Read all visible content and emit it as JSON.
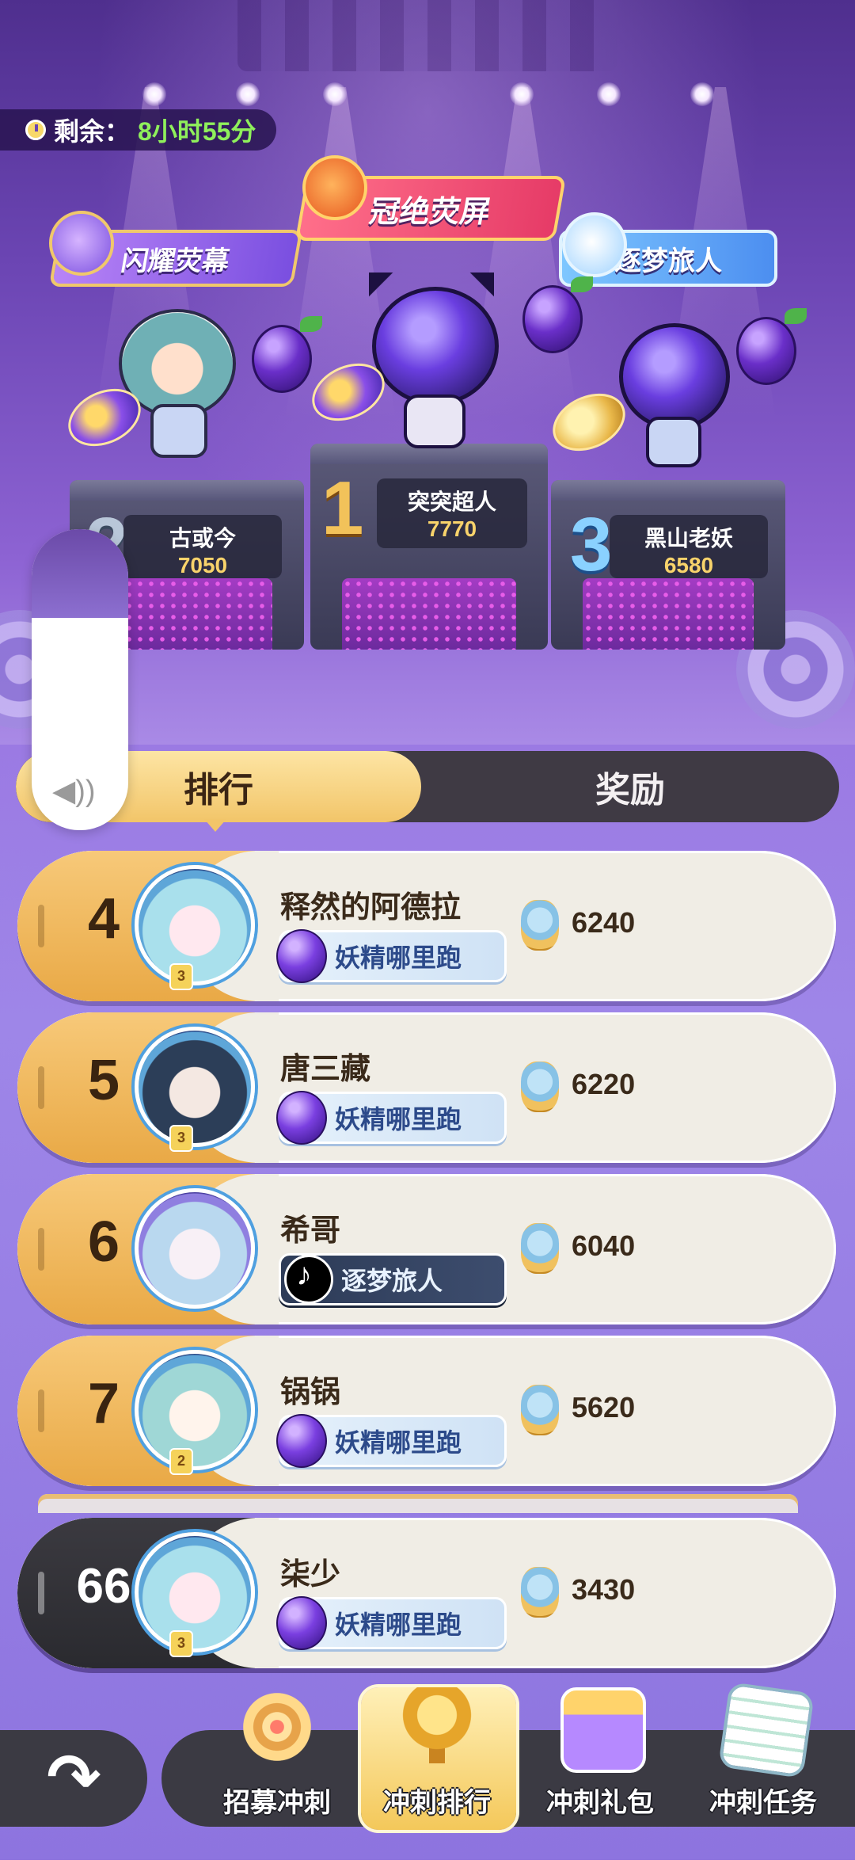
{
  "timer": {
    "label": "剩余：",
    "value": "8小时55分"
  },
  "banners": {
    "left": "闪耀荧幕",
    "center": "冠绝荧屏",
    "right": "逐梦旅人"
  },
  "podium": [
    {
      "rank": "1",
      "name": "突突超人",
      "score": "7770"
    },
    {
      "rank": "2",
      "name": "古或今",
      "score": "7050"
    },
    {
      "rank": "3",
      "name": "黑山老妖",
      "score": "6580"
    }
  ],
  "tabs": {
    "ranking": "排行",
    "rewards": "奖励"
  },
  "rows": [
    {
      "rank": "4",
      "name": "释然的阿德拉",
      "badge": "妖精哪里跑",
      "score": "6240",
      "level": "3"
    },
    {
      "rank": "5",
      "name": "唐三藏",
      "badge": "妖精哪里跑",
      "score": "6220",
      "level": "3"
    },
    {
      "rank": "6",
      "name": "希哥",
      "badge": "逐梦旅人",
      "score": "6040",
      "level": ""
    },
    {
      "rank": "7",
      "name": "锅锅",
      "badge": "妖精哪里跑",
      "score": "5620",
      "level": "2"
    }
  ],
  "me": {
    "rank": "66",
    "name": "柒少",
    "badge": "妖精哪里跑",
    "score": "3430",
    "level": "3"
  },
  "nav": {
    "items": [
      "招募冲刺",
      "冲刺排行",
      "冲刺礼包",
      "冲刺任务"
    ],
    "active": "冲刺排行"
  },
  "colors": {
    "timer_value": "#8ff05b",
    "tab_active": "#f2c569",
    "rank_me_bg": "#2a2a2f"
  }
}
